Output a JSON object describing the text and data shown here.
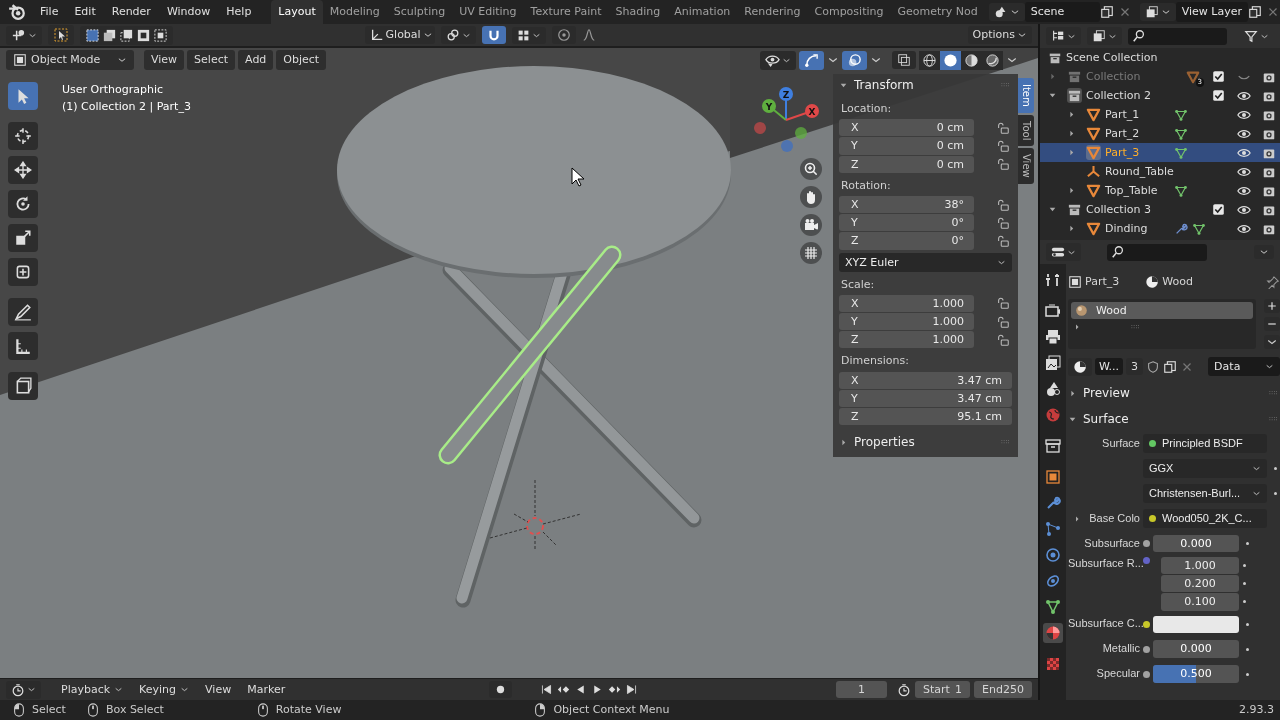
{
  "top_menu": [
    "File",
    "Edit",
    "Render",
    "Window",
    "Help"
  ],
  "workspaces": [
    {
      "label": "Layout",
      "selected": true
    },
    {
      "label": "Modeling",
      "selected": false
    },
    {
      "label": "Sculpting",
      "selected": false
    },
    {
      "label": "UV Editing",
      "selected": false
    },
    {
      "label": "Texture Paint",
      "selected": false
    },
    {
      "label": "Shading",
      "selected": false
    },
    {
      "label": "Animation",
      "selected": false
    },
    {
      "label": "Rendering",
      "selected": false
    },
    {
      "label": "Compositing",
      "selected": false
    },
    {
      "label": "Geometry Nod",
      "selected": false
    }
  ],
  "scene": {
    "value": "Scene"
  },
  "view_layer": {
    "value": "View Layer"
  },
  "tool_header": {
    "transform_orientation": "Global",
    "snap": true,
    "proportional_edit": false,
    "options": "Options"
  },
  "viewport_header": {
    "mode": "Object Mode",
    "menus": [
      "View",
      "Select",
      "Add",
      "Object"
    ],
    "gizmos": true,
    "overlays": true,
    "shading": [
      {
        "selected": false
      },
      {
        "selected": true
      },
      {
        "selected": false
      },
      {
        "selected": false
      }
    ]
  },
  "toolbar": [
    {
      "selected": true
    },
    {
      "selected": false
    },
    {
      "selected": false
    },
    {
      "selected": false
    },
    {
      "selected": false
    },
    {
      "selected": false
    },
    {
      "selected": false
    },
    {
      "selected": false
    },
    {
      "selected": false
    }
  ],
  "viewport": {
    "view_name": "User Orthographic",
    "object_info": "(1) Collection 2 | Part_3",
    "axes": [
      "X",
      "Y",
      "Z"
    ]
  },
  "sidebar": {
    "tabs": [
      {
        "label": "Item",
        "selected": true
      },
      {
        "label": "Tool",
        "selected": false
      },
      {
        "label": "View",
        "selected": false
      }
    ],
    "transform": {
      "title": "Transform",
      "expanded": true,
      "groups": [
        {
          "label": "Location:",
          "kind": "locked",
          "fields": [
            {
              "axis": "X",
              "value": "0 cm"
            },
            {
              "axis": "Y",
              "value": "0 cm"
            },
            {
              "axis": "Z",
              "value": "0 cm"
            }
          ]
        },
        {
          "label": "Rotation:",
          "kind": "locked",
          "fields": [
            {
              "axis": "X",
              "value": "38°"
            },
            {
              "axis": "Y",
              "value": "0°"
            },
            {
              "axis": "Z",
              "value": "0°"
            }
          ],
          "mode": "XYZ Euler"
        },
        {
          "label": "Scale:",
          "kind": "locked",
          "fields": [
            {
              "axis": "X",
              "value": "1.000"
            },
            {
              "axis": "Y",
              "value": "1.000"
            },
            {
              "axis": "Z",
              "value": "1.000"
            }
          ]
        },
        {
          "label": "Dimensions:",
          "kind": "plain",
          "fields": [
            {
              "axis": "X",
              "value": "3.47 cm"
            },
            {
              "axis": "Y",
              "value": "3.47 cm"
            },
            {
              "axis": "Z",
              "value": "95.1 cm"
            }
          ]
        }
      ]
    },
    "properties": {
      "title": "Properties",
      "expanded": false
    }
  },
  "outliner": {
    "root": "Scene Collection",
    "items": [
      {
        "label": "Collection",
        "kind": "collection",
        "expanded": false,
        "checked": true,
        "hidden": true,
        "active": false,
        "badge": "3",
        "selected": false
      },
      {
        "label": "Collection 2",
        "kind": "collection",
        "expanded": true,
        "checked": true,
        "hidden": false,
        "active": true,
        "selected": false,
        "children": [
          {
            "label": "Part_1",
            "kind": "mesh",
            "expanded": false,
            "modifier": false,
            "selected": false
          },
          {
            "label": "Part_2",
            "kind": "mesh",
            "expanded": false,
            "modifier": false,
            "selected": false
          },
          {
            "label": "Part_3",
            "kind": "mesh",
            "expanded": false,
            "modifier": false,
            "selected": true
          },
          {
            "label": "Round_Table",
            "kind": "empty",
            "selected": false
          },
          {
            "label": "Top_Table",
            "kind": "mesh",
            "expanded": false,
            "modifier": false,
            "selected": false
          }
        ]
      },
      {
        "label": "Collection 3",
        "kind": "collection",
        "expanded": true,
        "checked": true,
        "hidden": false,
        "active": false,
        "selected": false,
        "children": [
          {
            "label": "Dinding",
            "kind": "mesh",
            "expanded": false,
            "modifier": true,
            "selected": false
          }
        ]
      }
    ]
  },
  "properties": {
    "tabs": [
      {
        "selected": false
      },
      {
        "selected": false
      },
      {
        "selected": false
      },
      {
        "selected": false
      },
      {
        "selected": false
      },
      {
        "selected": false
      },
      {
        "selected": false
      },
      {
        "selected": false
      },
      {
        "selected": false
      },
      {
        "selected": false
      },
      {
        "selected": false
      },
      {
        "selected": false
      },
      {
        "selected": false
      },
      {
        "selected": true
      },
      {
        "selected": false
      }
    ],
    "context": {
      "object": "Part_3",
      "material": "Wood"
    },
    "material_slots": [
      {
        "label": "Wood",
        "selected": true
      }
    ],
    "datablock": {
      "name": "W...",
      "users": "3",
      "link": "Data"
    },
    "panels": [
      {
        "title": "Preview",
        "expanded": false
      },
      {
        "title": "Surface",
        "expanded": true,
        "rows": [
          {
            "kind": "link",
            "label": "Surface",
            "value": "Principled BSDF",
            "color": "#63c763"
          },
          {
            "kind": "enum",
            "value": "GGX"
          },
          {
            "kind": "enum",
            "value": "Christensen-Burl..."
          },
          {
            "kind": "texture",
            "label": "Base Colo",
            "value": "Wood050_2K_C...",
            "color": "#c7c729"
          },
          {
            "kind": "slider",
            "label": "Subsurface",
            "value": "0.000",
            "color": "#a1a1a1"
          },
          {
            "kind": "vector",
            "label": "Subsurface R...",
            "values": [
              "1.000",
              "0.200",
              "0.100"
            ],
            "color": "#6363c7"
          },
          {
            "kind": "color",
            "label": "Subsurface C...",
            "color": "#c7c729"
          },
          {
            "kind": "slider",
            "label": "Metallic",
            "value": "0.000",
            "color": "#a1a1a1"
          },
          {
            "kind": "slider",
            "label": "Specular",
            "value": "0.500",
            "level": 0.5,
            "color": "#a1a1a1"
          }
        ]
      }
    ]
  },
  "timeline": {
    "menus": [
      "Playback",
      "Keying",
      "View",
      "Marker"
    ],
    "auto_keying": false,
    "current_frame": "1",
    "start_label": "Start",
    "start": "1",
    "end_label": "End",
    "end": "250"
  },
  "status_bar": {
    "hints": [
      {
        "label": "Select"
      },
      {
        "label": "Box Select"
      },
      {
        "label": "Rotate View"
      },
      {
        "label": "Object Context Menu"
      }
    ],
    "version": "2.93.3"
  }
}
